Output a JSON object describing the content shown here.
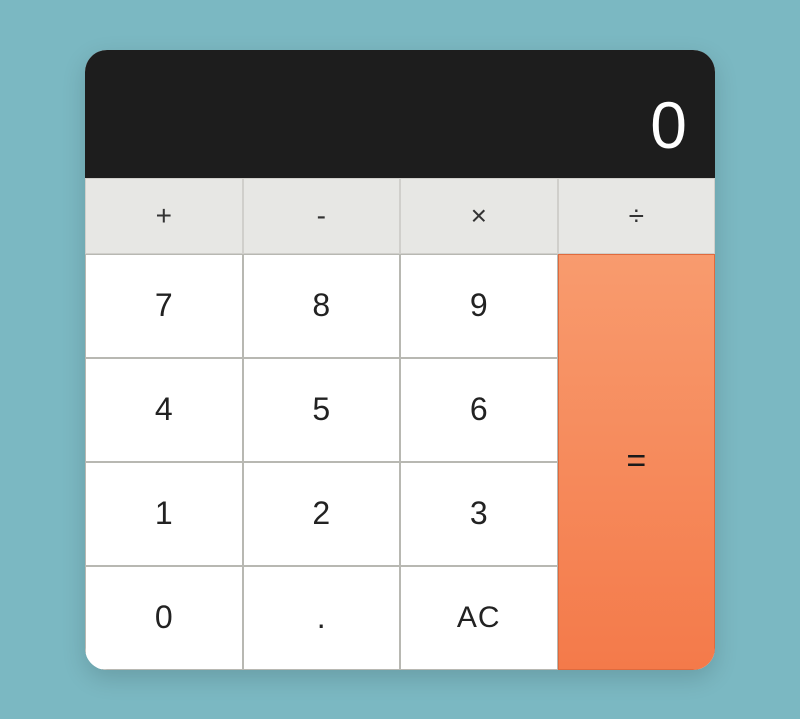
{
  "display": {
    "value": "0"
  },
  "operators": {
    "add": "+",
    "subtract": "-",
    "multiply": "×",
    "divide": "÷"
  },
  "keys": {
    "seven": "7",
    "eight": "8",
    "nine": "9",
    "four": "4",
    "five": "5",
    "six": "6",
    "one": "1",
    "two": "2",
    "three": "3",
    "zero": "0",
    "decimal": ".",
    "clear": "AC",
    "equals": "="
  },
  "colors": {
    "background": "#7bb8c2",
    "display_bg": "#1d1d1d",
    "operator_bg": "#e7e7e4",
    "number_bg": "#ffffff",
    "equals_bg": "#f47a4a"
  }
}
